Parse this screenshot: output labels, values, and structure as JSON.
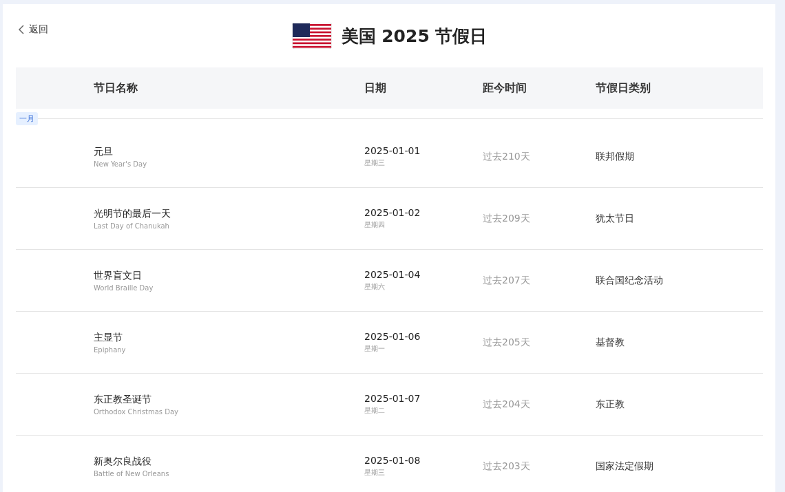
{
  "back": {
    "label": "返回"
  },
  "title": "美国 2025 节假日",
  "columns": [
    "节日名称",
    "日期",
    "距今时间",
    "节假日类别"
  ],
  "month": "一月",
  "rows": [
    {
      "name": "元旦",
      "name_en": "New Year's Day",
      "date": "2025-01-01",
      "weekday": "星期三",
      "distance": "过去210天",
      "category": "联邦假期"
    },
    {
      "name": "光明节的最后一天",
      "name_en": "Last Day of Chanukah",
      "date": "2025-01-02",
      "weekday": "星期四",
      "distance": "过去209天",
      "category": "犹太节日"
    },
    {
      "name": "世界盲文日",
      "name_en": "World Braille Day",
      "date": "2025-01-04",
      "weekday": "星期六",
      "distance": "过去207天",
      "category": "联合国纪念活动"
    },
    {
      "name": "主显节",
      "name_en": "Epiphany",
      "date": "2025-01-06",
      "weekday": "星期一",
      "distance": "过去205天",
      "category": "基督教"
    },
    {
      "name": "东正教圣诞节",
      "name_en": "Orthodox Christmas Day",
      "date": "2025-01-07",
      "weekday": "星期二",
      "distance": "过去204天",
      "category": "东正教"
    },
    {
      "name": "新奥尔良战役",
      "name_en": "Battle of New Orleans",
      "date": "2025-01-08",
      "weekday": "星期三",
      "distance": "过去203天",
      "category": "国家法定假期"
    }
  ]
}
